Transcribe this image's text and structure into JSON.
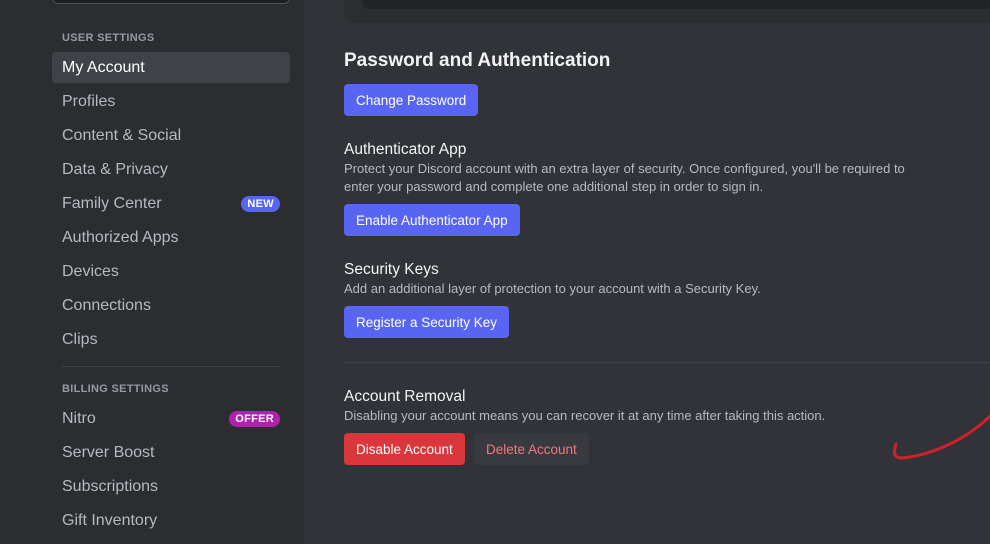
{
  "sidebar": {
    "user_settings_header": "USER SETTINGS",
    "billing_settings_header": "BILLING SETTINGS",
    "items": [
      {
        "label": "My Account"
      },
      {
        "label": "Profiles"
      },
      {
        "label": "Content & Social"
      },
      {
        "label": "Data & Privacy"
      },
      {
        "label": "Family Center",
        "badge": "NEW"
      },
      {
        "label": "Authorized Apps"
      },
      {
        "label": "Devices"
      },
      {
        "label": "Connections"
      },
      {
        "label": "Clips"
      }
    ],
    "billing_items": [
      {
        "label": "Nitro",
        "badge": "OFFER"
      },
      {
        "label": "Server Boost"
      },
      {
        "label": "Subscriptions"
      },
      {
        "label": "Gift Inventory"
      }
    ]
  },
  "main": {
    "password_title": "Password and Authentication",
    "change_password_button": "Change Password",
    "authenticator": {
      "title": "Authenticator App",
      "description": "Protect your Discord account with an extra layer of security. Once configured, you'll be required to enter your password and complete one additional step in order to sign in.",
      "button": "Enable Authenticator App"
    },
    "security_keys": {
      "title": "Security Keys",
      "description": "Add an additional layer of protection to your account with a Security Key.",
      "button": "Register a Security Key"
    },
    "account_removal": {
      "title": "Account Removal",
      "description": "Disabling your account means you can recover it at any time after taking this action.",
      "disable_button": "Disable Account",
      "delete_button": "Delete Account"
    }
  },
  "colors": {
    "accent": "#5865f2",
    "danger": "#da373c",
    "annotation": "#d1202a"
  }
}
